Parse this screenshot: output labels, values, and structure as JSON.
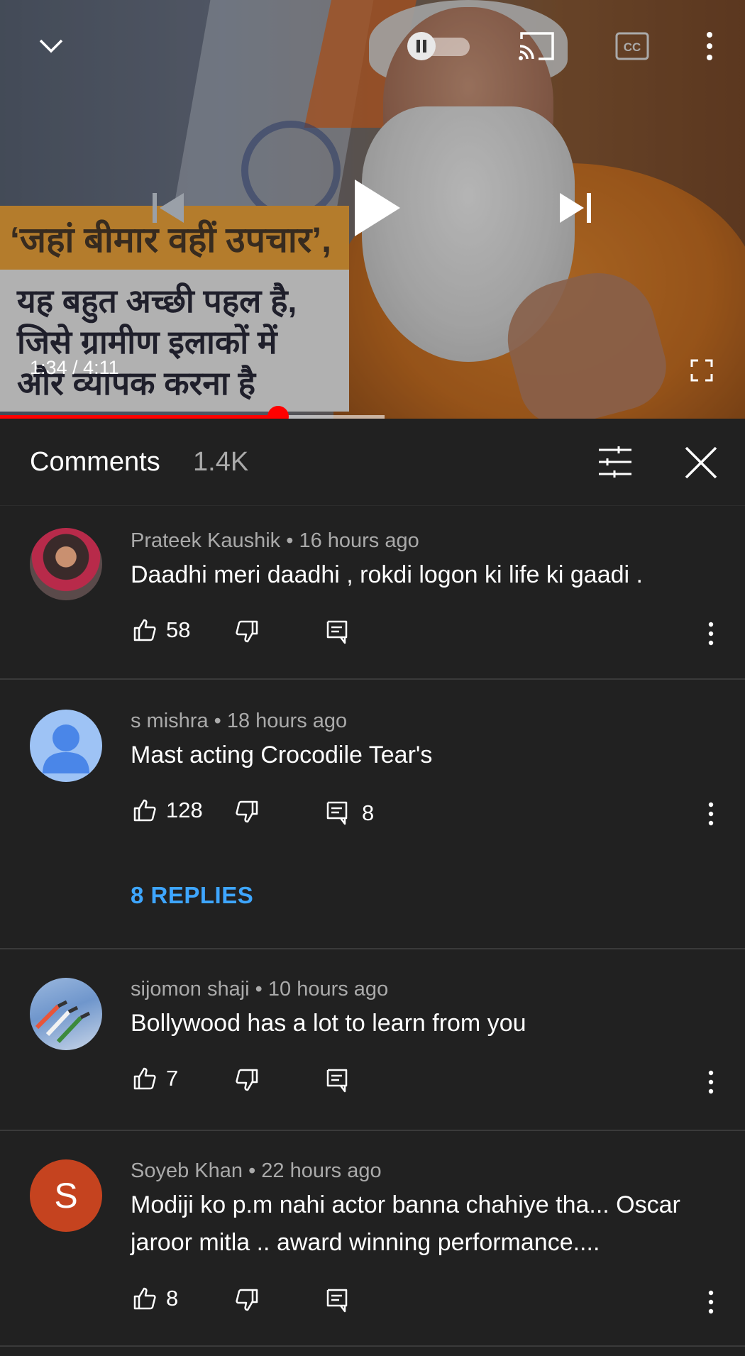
{
  "player": {
    "caption_line1": "‘जहां बीमार वहीं उपचार’,",
    "caption_lines": [
      "यह बहुत अच्छी पहल है,",
      "जिसे ग्रामीण इलाकों में",
      "और व्यापक करना है"
    ],
    "time": "1:34 / 4:11",
    "progress_fraction": 0.373,
    "buffered_fraction": 0.516
  },
  "comments_header": {
    "title": "Comments",
    "count": "1.4K"
  },
  "comments": [
    {
      "author_meta": "Prateek Kaushik • 16 hours ago",
      "text": "Daadhi meri daadhi , rokdi  logon ki life ki gaadi .",
      "likes": "58",
      "reply_count": ""
    },
    {
      "author_meta": "s mishra • 18 hours ago",
      "text": "Mast acting Crocodile Tear's",
      "likes": "128",
      "reply_count": "8",
      "replies_link": "8 REPLIES"
    },
    {
      "author_meta": "sijomon shaji • 10 hours ago",
      "text": "Bollywood has a lot to learn from you",
      "likes": "7",
      "reply_count": ""
    },
    {
      "author_meta": "Soyeb Khan • 22 hours ago",
      "avatar_letter": "S",
      "text": "Modiji ko p.m nahi actor banna chahiye tha... Oscar jaroor mitla .. award winning performance....",
      "likes": "8",
      "reply_count": ""
    }
  ],
  "colors": {
    "background": "#212121",
    "accent_red": "#ff0000",
    "link_blue": "#3ea6ff",
    "secondary_text": "#aaaaaa"
  },
  "icons": [
    "chevron-down-icon",
    "pause-icon",
    "cast-icon",
    "captions-icon",
    "more-vert-icon",
    "previous-icon",
    "play-icon",
    "next-icon",
    "fullscreen-icon",
    "filter-icon",
    "close-icon",
    "like-icon",
    "dislike-icon",
    "reply-icon"
  ]
}
